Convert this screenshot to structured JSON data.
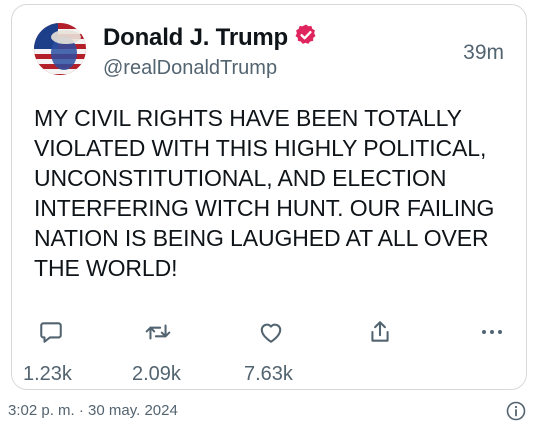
{
  "tweet": {
    "display_name": "Donald J. Trump",
    "handle": "@realDonaldTrump",
    "time_ago": "39m",
    "verified_icon": "verified-badge-icon",
    "brand_color": "#e0245e",
    "text": "MY CIVIL RIGHTS HAVE BEEN TOTALLY\nVIOLATED WITH THIS HIGHLY POLITICAL,\nUNCONSTITUTIONAL, AND ELECTION\nINTERFERING WITCH HUNT. OUR FAILING\nNATION IS BEING LAUGHED AT ALL OVER\nTHE WORLD!",
    "actions": {
      "reply": {
        "icon": "reply-icon",
        "count": "1.23k"
      },
      "retweet": {
        "icon": "retweet-icon",
        "count": "2.09k"
      },
      "like": {
        "icon": "heart-icon",
        "count": "7.63k"
      },
      "share": {
        "icon": "share-icon"
      },
      "more": {
        "icon": "more-icon"
      }
    }
  },
  "footer": {
    "date": "3:02 p. m. · 30 may. 2024",
    "info_icon": "info-icon"
  }
}
